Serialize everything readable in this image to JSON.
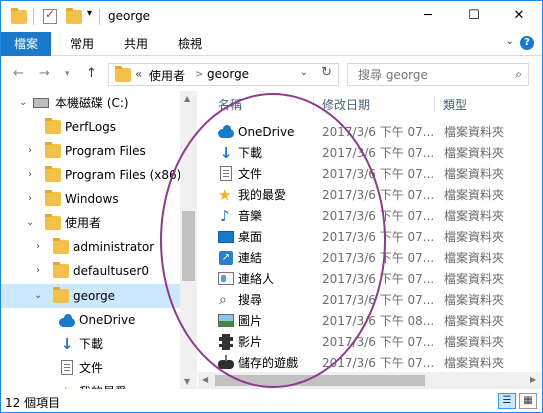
{
  "window": {
    "title": "george",
    "controls": {
      "minimize": "─",
      "maximize": "☐",
      "close": "✕"
    }
  },
  "ribbon": {
    "tabs": [
      "檔案",
      "常用",
      "共用",
      "檢視"
    ],
    "expand_icon": "chevron-down-icon",
    "help_glyph": "?"
  },
  "address": {
    "overflow": "«",
    "crumbs": [
      "使用者",
      "george"
    ],
    "separator": ">"
  },
  "search": {
    "placeholder": "搜尋 george"
  },
  "nav_tree": [
    {
      "label": "本機磁碟 (C:)",
      "icon": "drive-icon",
      "expanded": true,
      "indent": 1
    },
    {
      "label": "PerfLogs",
      "icon": "folder-icon",
      "indent": 2
    },
    {
      "label": "Program Files",
      "icon": "folder-icon",
      "indent": 2,
      "expandable": true
    },
    {
      "label": "Program Files (x86)",
      "icon": "folder-icon",
      "indent": 2,
      "expandable": true
    },
    {
      "label": "Windows",
      "icon": "folder-icon",
      "indent": 2,
      "expandable": true
    },
    {
      "label": "使用者",
      "icon": "folder-icon",
      "indent": 2,
      "expanded": true
    },
    {
      "label": "administrator",
      "icon": "folder-icon",
      "indent": 3,
      "expandable": true
    },
    {
      "label": "defaultuser0",
      "icon": "folder-icon",
      "indent": 3,
      "expandable": true
    },
    {
      "label": "george",
      "icon": "folder-icon",
      "indent": 3,
      "expanded": true,
      "selected": true
    },
    {
      "label": "OneDrive",
      "icon": "onedrive-icon",
      "indent": 4
    },
    {
      "label": "下載",
      "icon": "download-icon",
      "indent": 4
    },
    {
      "label": "文件",
      "icon": "document-icon",
      "indent": 4
    },
    {
      "label": "我的最愛",
      "icon": "star-icon",
      "indent": 4
    }
  ],
  "columns": {
    "name": "名稱",
    "date": "修改日期",
    "type": "類型"
  },
  "files": [
    {
      "name": "OneDrive",
      "date": "2017/3/6 下午 07...",
      "type": "檔案資料夾",
      "icon": "onedrive-icon"
    },
    {
      "name": "下載",
      "date": "2017/3/6 下午 07...",
      "type": "檔案資料夾",
      "icon": "download-icon"
    },
    {
      "name": "文件",
      "date": "2017/3/6 下午 07...",
      "type": "檔案資料夾",
      "icon": "document-icon"
    },
    {
      "name": "我的最愛",
      "date": "2017/3/6 下午 07...",
      "type": "檔案資料夾",
      "icon": "star-icon"
    },
    {
      "name": "音樂",
      "date": "2017/3/6 下午 07...",
      "type": "檔案資料夾",
      "icon": "music-icon"
    },
    {
      "name": "桌面",
      "date": "2017/3/6 下午 07...",
      "type": "檔案資料夾",
      "icon": "desktop-icon"
    },
    {
      "name": "連結",
      "date": "2017/3/6 下午 07...",
      "type": "檔案資料夾",
      "icon": "link-icon"
    },
    {
      "name": "連絡人",
      "date": "2017/3/6 下午 07...",
      "type": "檔案資料夾",
      "icon": "contacts-icon"
    },
    {
      "name": "搜尋",
      "date": "2017/3/6 下午 07...",
      "type": "檔案資料夾",
      "icon": "search-folder-icon"
    },
    {
      "name": "圖片",
      "date": "2017/3/6 下午 08...",
      "type": "檔案資料夾",
      "icon": "pictures-icon"
    },
    {
      "name": "影片",
      "date": "2017/3/6 下午 07...",
      "type": "檔案資料夾",
      "icon": "videos-icon"
    },
    {
      "name": "儲存的遊戲",
      "date": "2017/3/6 下午 07...",
      "type": "檔案資料夾",
      "icon": "saved-games-icon"
    }
  ],
  "status": {
    "item_count": "12 個項目"
  },
  "colors": {
    "accent": "#1979ca",
    "selection": "#cce8ff",
    "folder": "#f3c14a",
    "annotation": "#8e3a8e"
  }
}
